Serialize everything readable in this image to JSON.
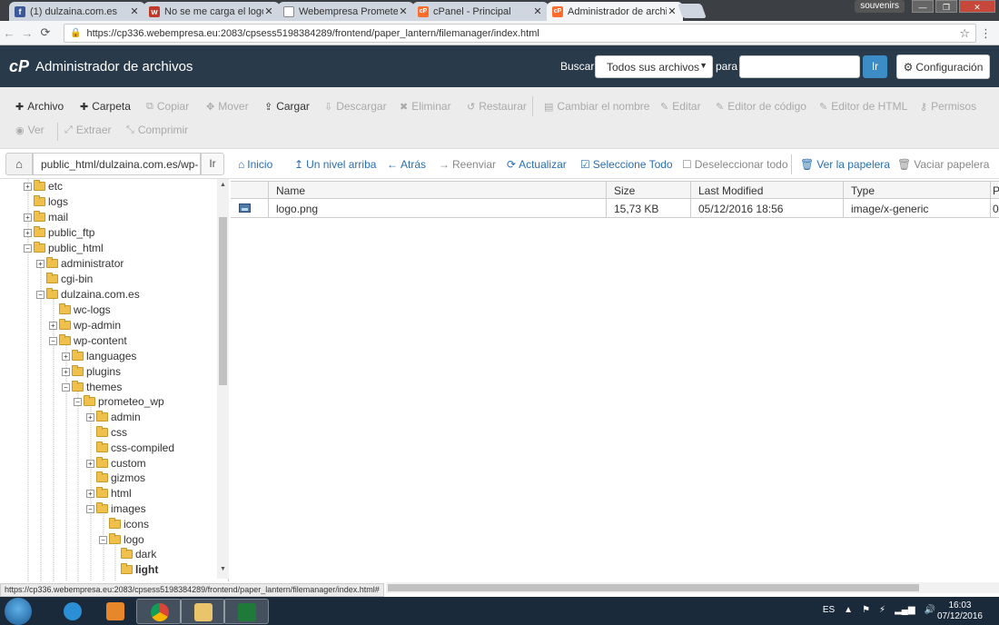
{
  "browser": {
    "tabs": [
      {
        "label": "(1) dulzaina.com.es",
        "favicon": "facebook-icon",
        "color": "#3b5998",
        "glyph": "f"
      },
      {
        "label": "No se me carga el logo e",
        "favicon": "wordpress-icon",
        "color": "#c0392b",
        "glyph": "w"
      },
      {
        "label": "Webempresa Prometeo",
        "favicon": "document-icon",
        "color": "#888888",
        "glyph": ""
      },
      {
        "label": "cPanel - Principal",
        "favicon": "cpanel-icon",
        "color": "#ff6c2c",
        "glyph": "cP"
      },
      {
        "label": "Administrador de archivo",
        "favicon": "cpanel-icon",
        "color": "#ff6c2c",
        "glyph": "cP"
      }
    ],
    "user_badge": "souvenirs",
    "url": "https://cp336.webempresa.eu:2083/cpsess5198384289/frontend/paper_lantern/filemanager/index.html"
  },
  "header": {
    "logo": "cP",
    "title": "Administrador de archivos",
    "search_label": "Buscar",
    "search_scope": "Todos sus archivos",
    "para_label": "para",
    "go_label": "Ir",
    "config_label": "Configuración"
  },
  "toolbar": {
    "row1": [
      {
        "label": "Archivo",
        "icon": "+",
        "enabled": true
      },
      {
        "label": "Carpeta",
        "icon": "+",
        "enabled": true
      },
      {
        "label": "Copiar",
        "icon": "⧉",
        "enabled": false
      },
      {
        "label": "Mover",
        "icon": "✥",
        "enabled": false
      },
      {
        "label": "Cargar",
        "icon": "⇪",
        "enabled": true
      },
      {
        "label": "Descargar",
        "icon": "⇩",
        "enabled": false
      },
      {
        "label": "Eliminar",
        "icon": "✖",
        "enabled": false
      },
      {
        "label": "Restaurar",
        "icon": "↺",
        "enabled": false
      },
      {
        "label": "Cambiar el nombre",
        "icon": "▤",
        "enabled": false
      },
      {
        "label": "Editar",
        "icon": "✎",
        "enabled": false
      },
      {
        "label": "Editor de código",
        "icon": "✎",
        "enabled": false
      },
      {
        "label": "Editor de HTML",
        "icon": "✎",
        "enabled": false
      },
      {
        "label": "Permisos",
        "icon": "⚷",
        "enabled": false
      }
    ],
    "row2": [
      {
        "label": "Ver",
        "icon": "◉",
        "enabled": false
      },
      {
        "label": "Extraer",
        "icon": "⤢",
        "enabled": false
      },
      {
        "label": "Comprimir",
        "icon": "⤡",
        "enabled": false
      }
    ]
  },
  "pathbar": {
    "path": "public_html/dulzaina.com.es/wp-",
    "go_label": "Ir"
  },
  "navbar": [
    {
      "label": "Inicio",
      "icon": "⌂",
      "enabled": true
    },
    {
      "label": "Un nivel arriba",
      "icon": "↥",
      "enabled": true
    },
    {
      "label": "Atrás",
      "icon": "←",
      "enabled": true
    },
    {
      "label": "Reenviar",
      "icon": "→",
      "enabled": false
    },
    {
      "label": "Actualizar",
      "icon": "⟳",
      "enabled": true
    },
    {
      "label": "Seleccione Todo",
      "icon": "☑",
      "enabled": true
    },
    {
      "label": "Deseleccionar todo",
      "icon": "☐",
      "enabled": false
    },
    {
      "label": "Ver la papelera",
      "icon": "🗑",
      "enabled": true
    },
    {
      "label": "Vaciar papelera",
      "icon": "🗑",
      "enabled": false
    }
  ],
  "tree": [
    {
      "label": "etc",
      "toggle": "+"
    },
    {
      "label": "logs",
      "toggle": ""
    },
    {
      "label": "mail",
      "toggle": "+"
    },
    {
      "label": "public_ftp",
      "toggle": "+"
    },
    {
      "label": "public_html",
      "toggle": "−"
    },
    {
      "label": "administrator",
      "toggle": "+"
    },
    {
      "label": "cgi-bin",
      "toggle": ""
    },
    {
      "label": "dulzaina.com.es",
      "toggle": "−"
    },
    {
      "label": "wc-logs",
      "toggle": ""
    },
    {
      "label": "wp-admin",
      "toggle": "+"
    },
    {
      "label": "wp-content",
      "toggle": "−"
    },
    {
      "label": "languages",
      "toggle": "+"
    },
    {
      "label": "plugins",
      "toggle": "+"
    },
    {
      "label": "themes",
      "toggle": "−"
    },
    {
      "label": "prometeo_wp",
      "toggle": "−"
    },
    {
      "label": "admin",
      "toggle": "+"
    },
    {
      "label": "css",
      "toggle": ""
    },
    {
      "label": "css-compiled",
      "toggle": ""
    },
    {
      "label": "custom",
      "toggle": "+"
    },
    {
      "label": "gizmos",
      "toggle": ""
    },
    {
      "label": "html",
      "toggle": "+"
    },
    {
      "label": "images",
      "toggle": "−"
    },
    {
      "label": "icons",
      "toggle": ""
    },
    {
      "label": "logo",
      "toggle": "−"
    },
    {
      "label": "dark",
      "toggle": ""
    },
    {
      "label": "light",
      "toggle": "",
      "selected": true
    }
  ],
  "table": {
    "columns": [
      "Name",
      "Size",
      "Last Modified",
      "Type",
      "P"
    ],
    "rows": [
      {
        "name": "logo.png",
        "size": "15,73 KB",
        "modified": "05/12/2016 18:56",
        "type": "image/x-generic",
        "perm": "0"
      }
    ]
  },
  "status_url": "https://cp336.webempresa.eu:2083/cpsess5198384289/frontend/paper_lantern/filemanager/index.html#",
  "taskbar": {
    "lang": "ES",
    "time": "16:03",
    "date": "07/12/2016"
  }
}
